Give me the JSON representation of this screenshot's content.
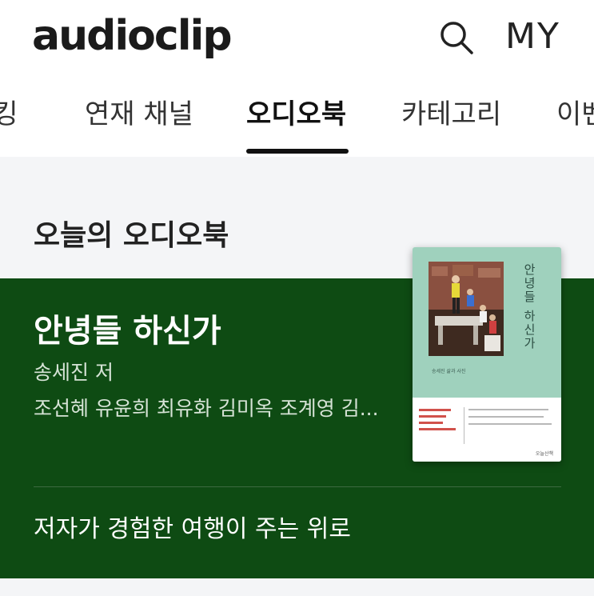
{
  "header": {
    "logo": "audioclip",
    "my_label": "MY"
  },
  "tabs": [
    {
      "label": "랭킹",
      "active": false
    },
    {
      "label": "연재 채널",
      "active": false
    },
    {
      "label": "오디오북",
      "active": true
    },
    {
      "label": "카테고리",
      "active": false
    },
    {
      "label": "이벤트",
      "active": false
    }
  ],
  "section": {
    "title": "오늘의 오디오북"
  },
  "featured": {
    "title": "안녕들 하신가",
    "author": "송세진 저",
    "narrators": "조선혜 유윤희 최유화 김미옥 조계영 김...",
    "description": "저자가 경험한 여행이 주는 위로",
    "cover": {
      "vertical_title": "안녕들 하신가",
      "author": "송세진 삶과 사진",
      "publisher": "오늘산책"
    }
  },
  "colors": {
    "card_background": "#0e4b13",
    "cover_mint": "#9fd1bd",
    "section_background": "#f4f5f7"
  },
  "icons": {
    "search": "search-icon"
  }
}
